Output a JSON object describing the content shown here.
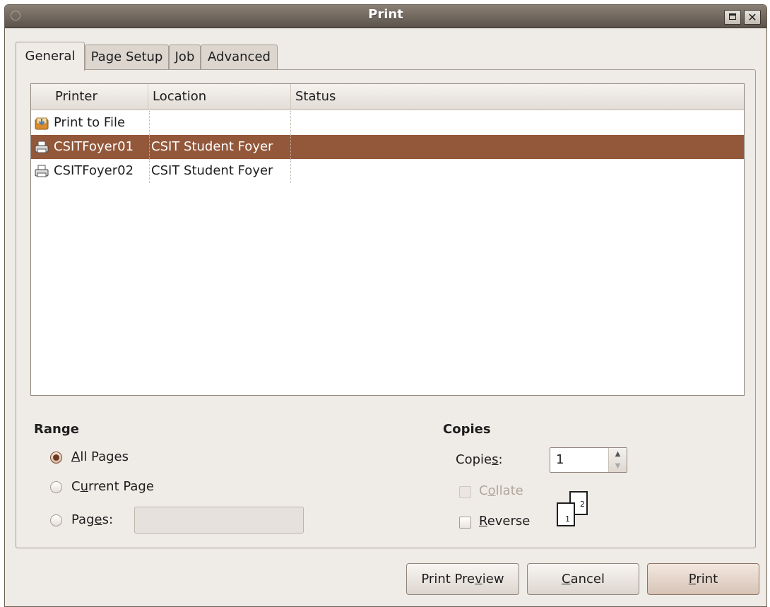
{
  "window": {
    "title": "Print"
  },
  "tabs": [
    {
      "label": "General",
      "active": true
    },
    {
      "label": "Page Setup",
      "active": false
    },
    {
      "label": "Job",
      "active": false
    },
    {
      "label": "Advanced",
      "active": false
    }
  ],
  "printer_list": {
    "columns": [
      "Printer",
      "Location",
      "Status"
    ],
    "rows": [
      {
        "icon": "print-to-file-icon",
        "printer": "Print to File",
        "location": "",
        "status": "",
        "selected": false
      },
      {
        "icon": "printer-icon",
        "printer": "CSITFoyer01",
        "location": "CSIT Student Foyer",
        "status": "",
        "selected": true
      },
      {
        "icon": "printer-icon",
        "printer": "CSITFoyer02",
        "location": "CSIT Student Foyer",
        "status": "",
        "selected": false
      }
    ]
  },
  "range": {
    "title": "Range",
    "options": [
      {
        "label": "All Pages",
        "mnemonic": "A",
        "rest": "ll Pages",
        "checked": true
      },
      {
        "label": "Current Page",
        "mnemonic": "u",
        "prefix": "C",
        "rest": "rrent Page",
        "checked": false
      },
      {
        "label": "Pages:",
        "mnemonic": "e",
        "prefix": "Pag",
        "rest": "s:",
        "checked": false
      }
    ],
    "pages_value": ""
  },
  "copies": {
    "title": "Copies",
    "label_prefix": "Copie",
    "label_mnemonic": "s",
    "label_suffix": ":",
    "value": "1",
    "collate": {
      "label_prefix": "C",
      "mnemonic": "o",
      "label_rest": "llate",
      "checked": false,
      "enabled": false
    },
    "reverse": {
      "mnemonic": "R",
      "label_rest": "everse",
      "checked": false
    },
    "diagram_pages": [
      "1",
      "2"
    ]
  },
  "buttons": {
    "preview_prefix": "Print Pre",
    "preview_mnemonic": "v",
    "preview_suffix": "iew",
    "cancel_mnemonic": "C",
    "cancel_rest": "ancel",
    "print_mnemonic": "P",
    "print_rest": "rint"
  },
  "colors": {
    "selection": "#93573a",
    "window_bg": "#efebe7",
    "titlebar": "#5b534b"
  }
}
